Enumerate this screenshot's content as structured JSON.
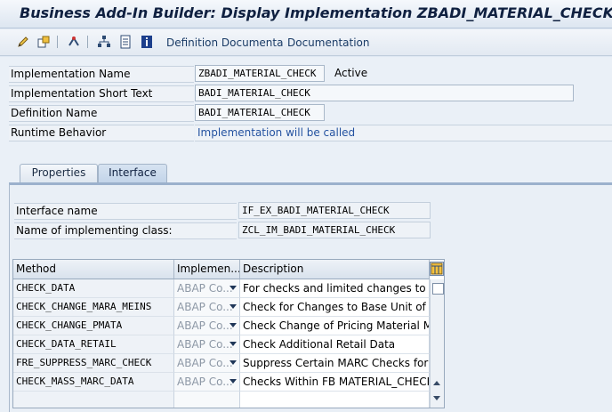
{
  "window": {
    "title": "Business Add-In Builder: Display Implementation ZBADI_MATERIAL_CHECK"
  },
  "toolbar": {
    "icons": [
      "edit-pencil-icon",
      "other-object-icon",
      "where-used-icon",
      "hierarchy-icon",
      "list-icon",
      "info-icon"
    ],
    "definition_documentation": "Definition Documenta",
    "documentation": "Documentation"
  },
  "header": {
    "implementation_name_label": "Implementation Name",
    "implementation_name_value": "ZBADI_MATERIAL_CHECK",
    "status": "Active",
    "short_text_label": "Implementation Short Text",
    "short_text_value": "BADI_MATERIAL_CHECK",
    "definition_name_label": "Definition Name",
    "definition_name_value": "BADI_MATERIAL_CHECK",
    "runtime_behavior_label": "Runtime Behavior",
    "runtime_behavior_value": "Implementation will be called"
  },
  "tabs": [
    {
      "label": "Properties",
      "active": false
    },
    {
      "label": "Interface",
      "active": true
    }
  ],
  "interface": {
    "interface_name_label": "Interface name",
    "interface_name_value": "IF_EX_BADI_MATERIAL_CHECK",
    "impl_class_label": "Name of implementing class:",
    "impl_class_value": "ZCL_IM_BADI_MATERIAL_CHECK"
  },
  "methods_table": {
    "columns": [
      "Method",
      "Implemen...",
      "Description"
    ],
    "rows": [
      {
        "method": "CHECK_DATA",
        "impl": "ABAP Co...",
        "description": "For checks and limited changes to ma"
      },
      {
        "method": "CHECK_CHANGE_MARA_MEINS",
        "impl": "ABAP Co...",
        "description": "Check for Changes to Base Unit of Me"
      },
      {
        "method": "CHECK_CHANGE_PMATA",
        "impl": "ABAP Co...",
        "description": "Check Change of Pricing Material MAR."
      },
      {
        "method": "CHECK_DATA_RETAIL",
        "impl": "ABAP Co...",
        "description": "Check Additional Retail Data"
      },
      {
        "method": "FRE_SUPPRESS_MARC_CHECK",
        "impl": "ABAP Co...",
        "description": "Suppress Certain MARC Checks for F&I"
      },
      {
        "method": "CHECK_MASS_MARC_DATA",
        "impl": "ABAP Co...",
        "description": "Checks Within FB MATERIAL_CHECK_I"
      },
      {
        "method": "",
        "impl": "",
        "description": ""
      }
    ]
  },
  "colors": {
    "title_text": "#0f2040",
    "link_text": "#1a3b66",
    "runtime_text": "#2452a0",
    "panel_border": "#9bb1cc"
  }
}
